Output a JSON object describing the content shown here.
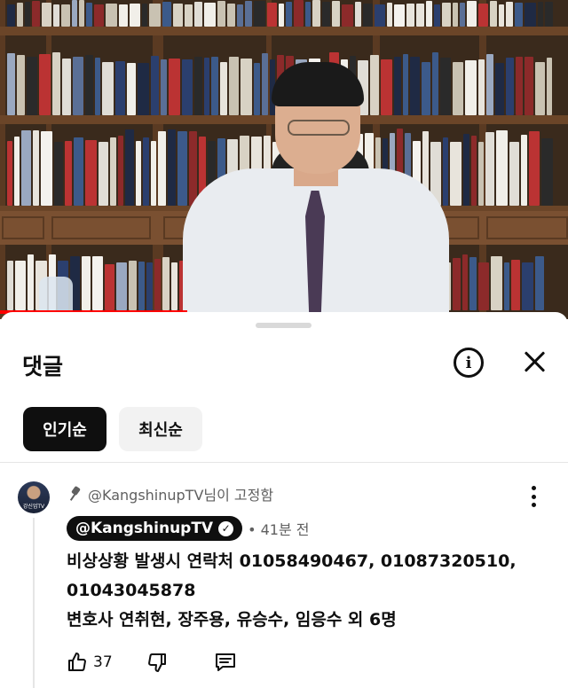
{
  "panel": {
    "title": "댓글",
    "info_icon": "info-icon",
    "close_icon": "close-icon"
  },
  "sort": {
    "top_label": "인기순",
    "newest_label": "최신순",
    "selected": "인기순"
  },
  "comment": {
    "pinned_text": "@KangshinupTV님이 고정함",
    "author": "@KangshinupTV",
    "time": "• 41분 전",
    "avatar_text": "강신업TV",
    "lines": [
      "비상상황 발생시 연락처 01058490467, 01087320510,",
      "01043045878",
      "변호사 연취현, 장주용, 유승수, 임응수 외 6명"
    ],
    "like_count": "37"
  },
  "colors": {
    "progress": "#ff0000",
    "chip_selected_bg": "#0f0f0f",
    "chip_bg": "#f2f2f2",
    "meta_text": "#606060"
  },
  "video": {
    "progress_fraction": 0.33
  }
}
